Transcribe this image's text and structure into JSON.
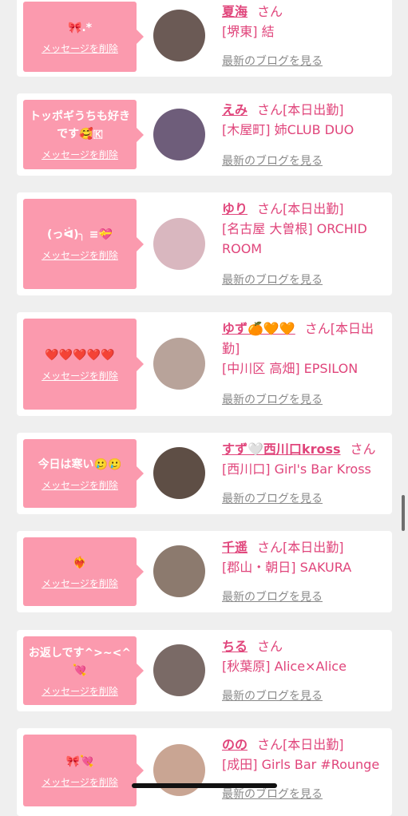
{
  "common": {
    "delete_label": "メッセージを削除",
    "blog_label": "最新のブログを見る",
    "san": "さん"
  },
  "entries": [
    {
      "message": "🎀.*",
      "name": "夏海",
      "status": "",
      "shop": "[堺東] 結",
      "avatar_color": "#6b5a55"
    },
    {
      "message": "トッポギうちも好きです🥰🇰",
      "name": "えみ",
      "status": "[本日出勤]",
      "shop": "[木屋町] 姉CLUB DUO",
      "avatar_color": "#6e5d7a"
    },
    {
      "message": "(っᐛ)╮ ≡💝",
      "name": "ゆり",
      "status": "[本日出勤]",
      "shop": "[名古屋 大曽根] ORCHID ROOM",
      "avatar_color": "#d9b7bf"
    },
    {
      "message": "❤️❤️❤️❤️❤️",
      "name": "ゆず🍊🧡🧡",
      "status": "[本日出勤]",
      "shop": "[中川区 高畑] EPSILON",
      "avatar_color": "#b8a39a"
    },
    {
      "message": "今日は寒い🥲🥲",
      "name": "すず🤍西川口kross",
      "status": "",
      "shop": "[西川口] Girl's Bar Kross",
      "avatar_color": "#5e4e45"
    },
    {
      "message": "❤️‍🔥",
      "name": "千遥",
      "status": "[本日出勤]",
      "shop": "[郡山・朝日] SAKURA",
      "avatar_color": "#8c7a6e"
    },
    {
      "message": "お返しです^>~<^💘",
      "name": "ちる",
      "status": "",
      "shop": "[秋葉原] Alice×Alice",
      "avatar_color": "#7a6a66"
    },
    {
      "message": "🎀💘",
      "name": "のの",
      "status": "[本日出勤]",
      "shop": "[成田] Girls Bar #Rounge",
      "avatar_color": "#c9a593"
    }
  ],
  "colors": {
    "accent": "#e0457b",
    "bubble": "#fb9aae",
    "background": "#efefef"
  }
}
